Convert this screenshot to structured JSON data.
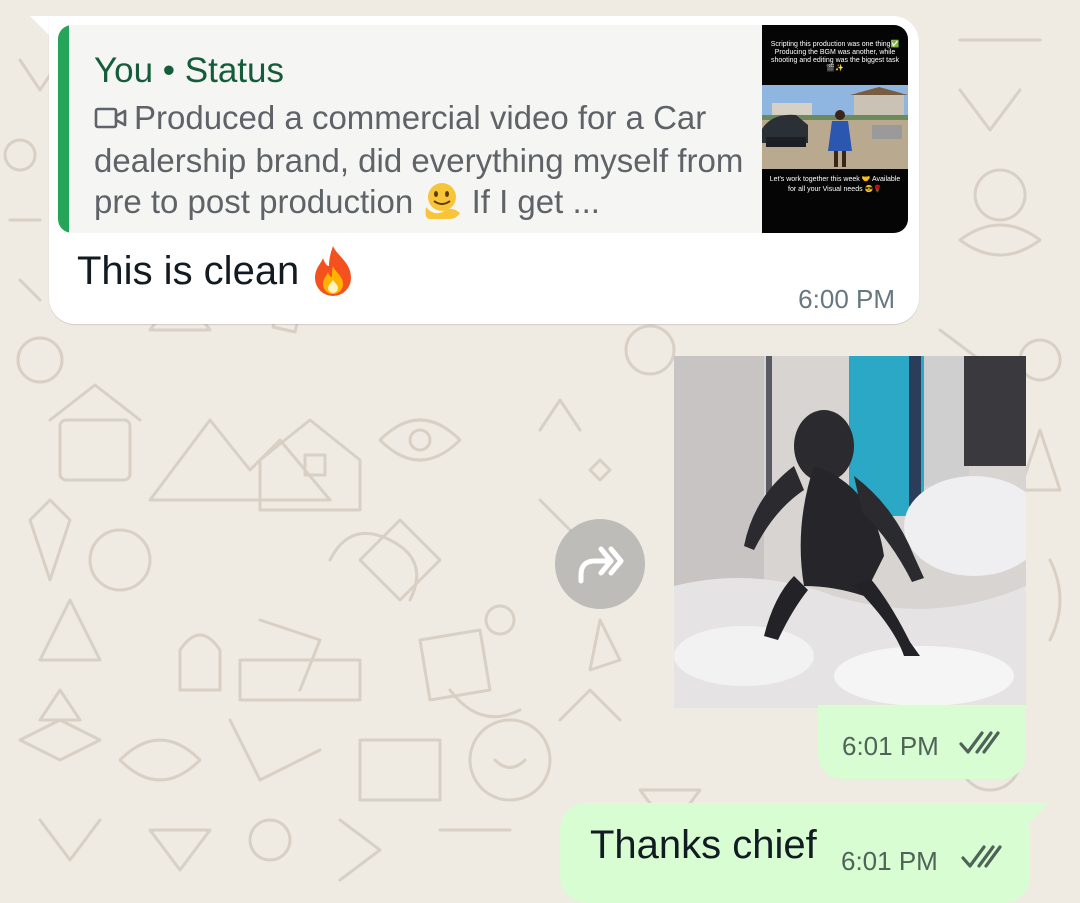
{
  "incoming": {
    "quote": {
      "author": "You • Status",
      "text": "Produced a commercial video for a Car dealership brand, did everything myself from pre to post production",
      "text_end": "If I get ...",
      "thumbnail": {
        "top_caption": "Scripting this production was one thing✅ Producing the BGM was another, while shooting and editing was the biggest task 🎬✨",
        "bottom_caption": "Let's work together this week 🤝 Available for all your Visual needs 😎🌹"
      }
    },
    "message": "This is clean",
    "time": "6:00 PM"
  },
  "outgoing": [
    {
      "type": "image",
      "time": "6:01 PM",
      "status": "read"
    },
    {
      "type": "text",
      "text": "Thanks chief",
      "time": "6:01 PM",
      "status": "read"
    }
  ],
  "icons": {
    "forward": "forward-icon",
    "read_receipt": "double-check-icon"
  },
  "colors": {
    "chat_background": "#efeae2",
    "incoming_bubble": "#ffffff",
    "outgoing_bubble": "#d9fdd3",
    "quote_accent": "#25a55a",
    "quote_author": "#145c3a"
  }
}
